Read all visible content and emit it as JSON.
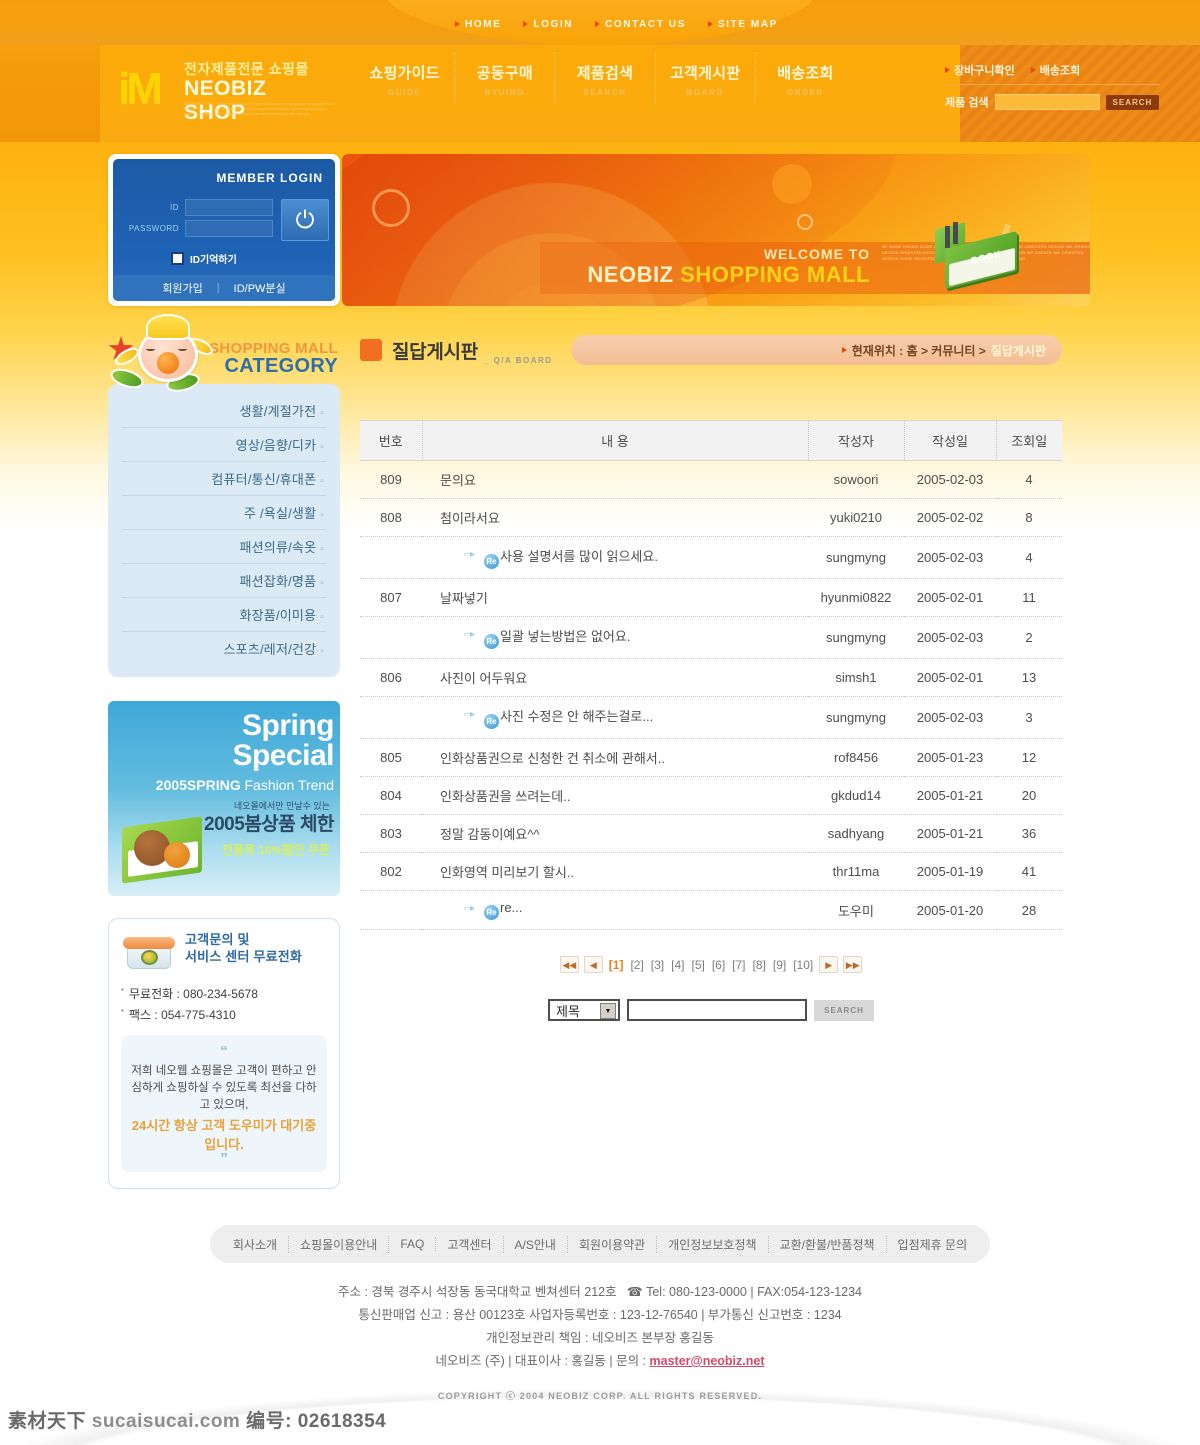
{
  "topnav": [
    {
      "label": "HOME"
    },
    {
      "label": "LOGIN"
    },
    {
      "label": "CONTACT US"
    },
    {
      "label": "SITE MAP"
    }
  ],
  "logo": {
    "mark": "iM",
    "korean": "전자제품전문 쇼핑몰",
    "english": "NEOBIZ SHOP",
    "description": "NEOBIZBIZCOM - Intelligence that has heightened cancer in the gold of the practitioner to double that a group of Networks a ground shade the United States is preparing to launch a range as G.S. counterterrorism and law enforcement officials say."
  },
  "mainnav": [
    {
      "ko": "쇼핑가이드",
      "en": "GUIDE"
    },
    {
      "ko": "공동구매",
      "en": "BYUING"
    },
    {
      "ko": "제품검색",
      "en": "SEARCH"
    },
    {
      "ko": "고객게시판",
      "en": "BOARD"
    },
    {
      "ko": "배송조회",
      "en": "ORDER"
    }
  ],
  "util": {
    "links": [
      {
        "label": "장바구니확인"
      },
      {
        "label": "배송조회"
      }
    ],
    "search_label": "제품 검색",
    "search_value": "",
    "search_placeholder": "",
    "search_button": "SEARCH"
  },
  "login": {
    "title": "MEMBER LOGIN",
    "id_label": "ID",
    "id_value": "",
    "pw_label": "PASSWORD",
    "pw_value": "",
    "go_icon": "power-icon",
    "remember_label": "ID기억하기",
    "join_label": "회원가입",
    "separator": "|",
    "findpw_label": "ID/PW분실"
  },
  "banner": {
    "welcome": "WELCOME TO",
    "mall_pre": "NEOBIZ ",
    "mall_em": "SHOPPING MALL",
    "blurb": "3D GAME PROMO DAME ORIENTED DESIGN ODD TYPE DESIGN WE ORIENTED DESIGN WE ORIENTED DESIGN ORIENTED DESIGN 3D GAME PROGRAM ORIENTED DESIGN WE CREATE WE ORIENTED DESIGN DOME ORIENTED DESIGN ONE WE ORIENTED DESIGN LINE",
    "book_label": "BOOK"
  },
  "category": {
    "title_line1": "SHOPPING MALL",
    "title_line2": "CATEGORY",
    "items": [
      {
        "label": "생활/계절가전"
      },
      {
        "label": "영상/음향/디카"
      },
      {
        "label": "컴퓨터/통신/휴대폰"
      },
      {
        "label": "주 /욕실/생활"
      },
      {
        "label": "패션의류/속옷"
      },
      {
        "label": "패션잡화/명품"
      },
      {
        "label": "화장품/이미용"
      },
      {
        "label": "스포츠/레저/건강"
      }
    ]
  },
  "spring_banner": {
    "line1": "Spring",
    "line2": "Special",
    "line3_bold": "2005SPRING",
    "line3_rest": " Fashion Trend",
    "line4": "네오몰에서만 만날수 있는",
    "line5": "2005봄상품 체한",
    "line6": "전품목 10%할인 쿠폰"
  },
  "customer_service": {
    "title_line1": "고객문의 및",
    "title_line2": "서비스 센터 무료전화",
    "lines": [
      {
        "label": "무료전화 : 080-234-5678"
      },
      {
        "label": "팩스 : 054-775-4310"
      }
    ],
    "quote_open": "“",
    "quote_text": "저희 네오웹 쇼핑몰은 고객이 편하고 안심하게 쇼핑하실 수 있도록 최선을 다하고 있으며,",
    "quote_highlight": "24시간 항상 고객 도우미가 대기중입니다.",
    "quote_close": "”"
  },
  "page": {
    "title": "질답게시판",
    "subtitle": "_ Q/A BOARD",
    "breadcrumb_prefix": "현재위치 : 홈 > 커뮤니티 > ",
    "breadcrumb_current": "질답게시판"
  },
  "board": {
    "headers": [
      "번호",
      "내 용",
      "작성자",
      "작성일",
      "조회일"
    ],
    "rows": [
      {
        "no": "809",
        "subject": "문의요",
        "reply": false,
        "author": "sowoori",
        "date": "2005-02-03",
        "views": "4"
      },
      {
        "no": "808",
        "subject": "첨이라서요",
        "reply": false,
        "author": "yuki0210",
        "date": "2005-02-02",
        "views": "8"
      },
      {
        "no": "",
        "subject": "사용 설명서를 많이 읽으세요.",
        "reply": true,
        "author": "sungmyng",
        "date": "2005-02-03",
        "views": "4"
      },
      {
        "no": "807",
        "subject": "날짜넣기",
        "reply": false,
        "author": "hyunmi0822",
        "date": "2005-02-01",
        "views": "11"
      },
      {
        "no": "",
        "subject": "일괄 넣는방법은 없어요.",
        "reply": true,
        "author": "sungmyng",
        "date": "2005-02-03",
        "views": "2"
      },
      {
        "no": "806",
        "subject": "사진이 어두워요",
        "reply": false,
        "author": "simsh1",
        "date": "2005-02-01",
        "views": "13"
      },
      {
        "no": "",
        "subject": "사진 수정은 안 해주는걸로...",
        "reply": true,
        "author": "sungmyng",
        "date": "2005-02-03",
        "views": "3"
      },
      {
        "no": "805",
        "subject": "인화상품권으로 신청한 건 취소에 관해서..",
        "reply": false,
        "author": "rof8456",
        "date": "2005-01-23",
        "views": "12"
      },
      {
        "no": "804",
        "subject": "인화상품권을 쓰려는데..",
        "reply": false,
        "author": "gkdud14",
        "date": "2005-01-21",
        "views": "20"
      },
      {
        "no": "803",
        "subject": "정말 감동이예요^^",
        "reply": false,
        "author": "sadhyang",
        "date": "2005-01-21",
        "views": "36"
      },
      {
        "no": "802",
        "subject": "인화영역 미리보기 할시..",
        "reply": false,
        "author": "thr11ma",
        "date": "2005-01-19",
        "views": "41"
      },
      {
        "no": "",
        "subject": "re...",
        "reply": true,
        "author": "도우미",
        "date": "2005-01-20",
        "views": "28"
      }
    ],
    "re_badge": "Re"
  },
  "pager": {
    "first": "◀◀",
    "prev": "◀",
    "next": "▶",
    "last": "▶▶",
    "pages": [
      "[1]",
      "[2]",
      "[3]",
      "[4]",
      "[5]",
      "[6]",
      "[7]",
      "[8]",
      "[9]",
      "[10]"
    ],
    "active_index": 0
  },
  "board_search": {
    "select_value": "제목",
    "input_value": "",
    "button": "SEARCH"
  },
  "footer": {
    "nav": [
      {
        "label": "회사소개"
      },
      {
        "label": "쇼핑몰이용안내"
      },
      {
        "label": "FAQ"
      },
      {
        "label": "고객센터"
      },
      {
        "label": "A/S안내"
      },
      {
        "label": "회원이용약관"
      },
      {
        "label": "개인정보보호정책"
      },
      {
        "label": "교환/환불/반품정책"
      },
      {
        "label": "입점제휴 문의"
      }
    ],
    "address": "주소 : 경북 경주시 석장동 동국대학교 벤쳐센터 212호",
    "tel": "Tel: 080-123-0000 | FAX:054-123-1234",
    "line2": "통신판매업 신고 : 용산 00123호 사업자등록번호 : 123-12-76540 | 부가통신 신고번호 : 1234",
    "line3": "개인정보관리 책임 : 네오비즈 본부장 홍길동",
    "line4_pre": "네오비즈 (주) | 대표이사 : 홍길동 | 문의 : ",
    "email": "master@neobiz.net",
    "copyright": "COPYRIGHT ⓒ 2004 NEOBIZ CORP. ALL RIGHTS RESERVED."
  },
  "watermark": {
    "cn": "素材天下",
    "site": "sucaisucai.com",
    "id_label": "编号:",
    "id_value": "02618354"
  },
  "colors": {
    "brand_orange": "#f79d0c",
    "accent_orange": "#f26f21",
    "login_blue": "#1e62b4",
    "category_blue": "#dbeaf4",
    "email_pink": "#d14a6a"
  }
}
